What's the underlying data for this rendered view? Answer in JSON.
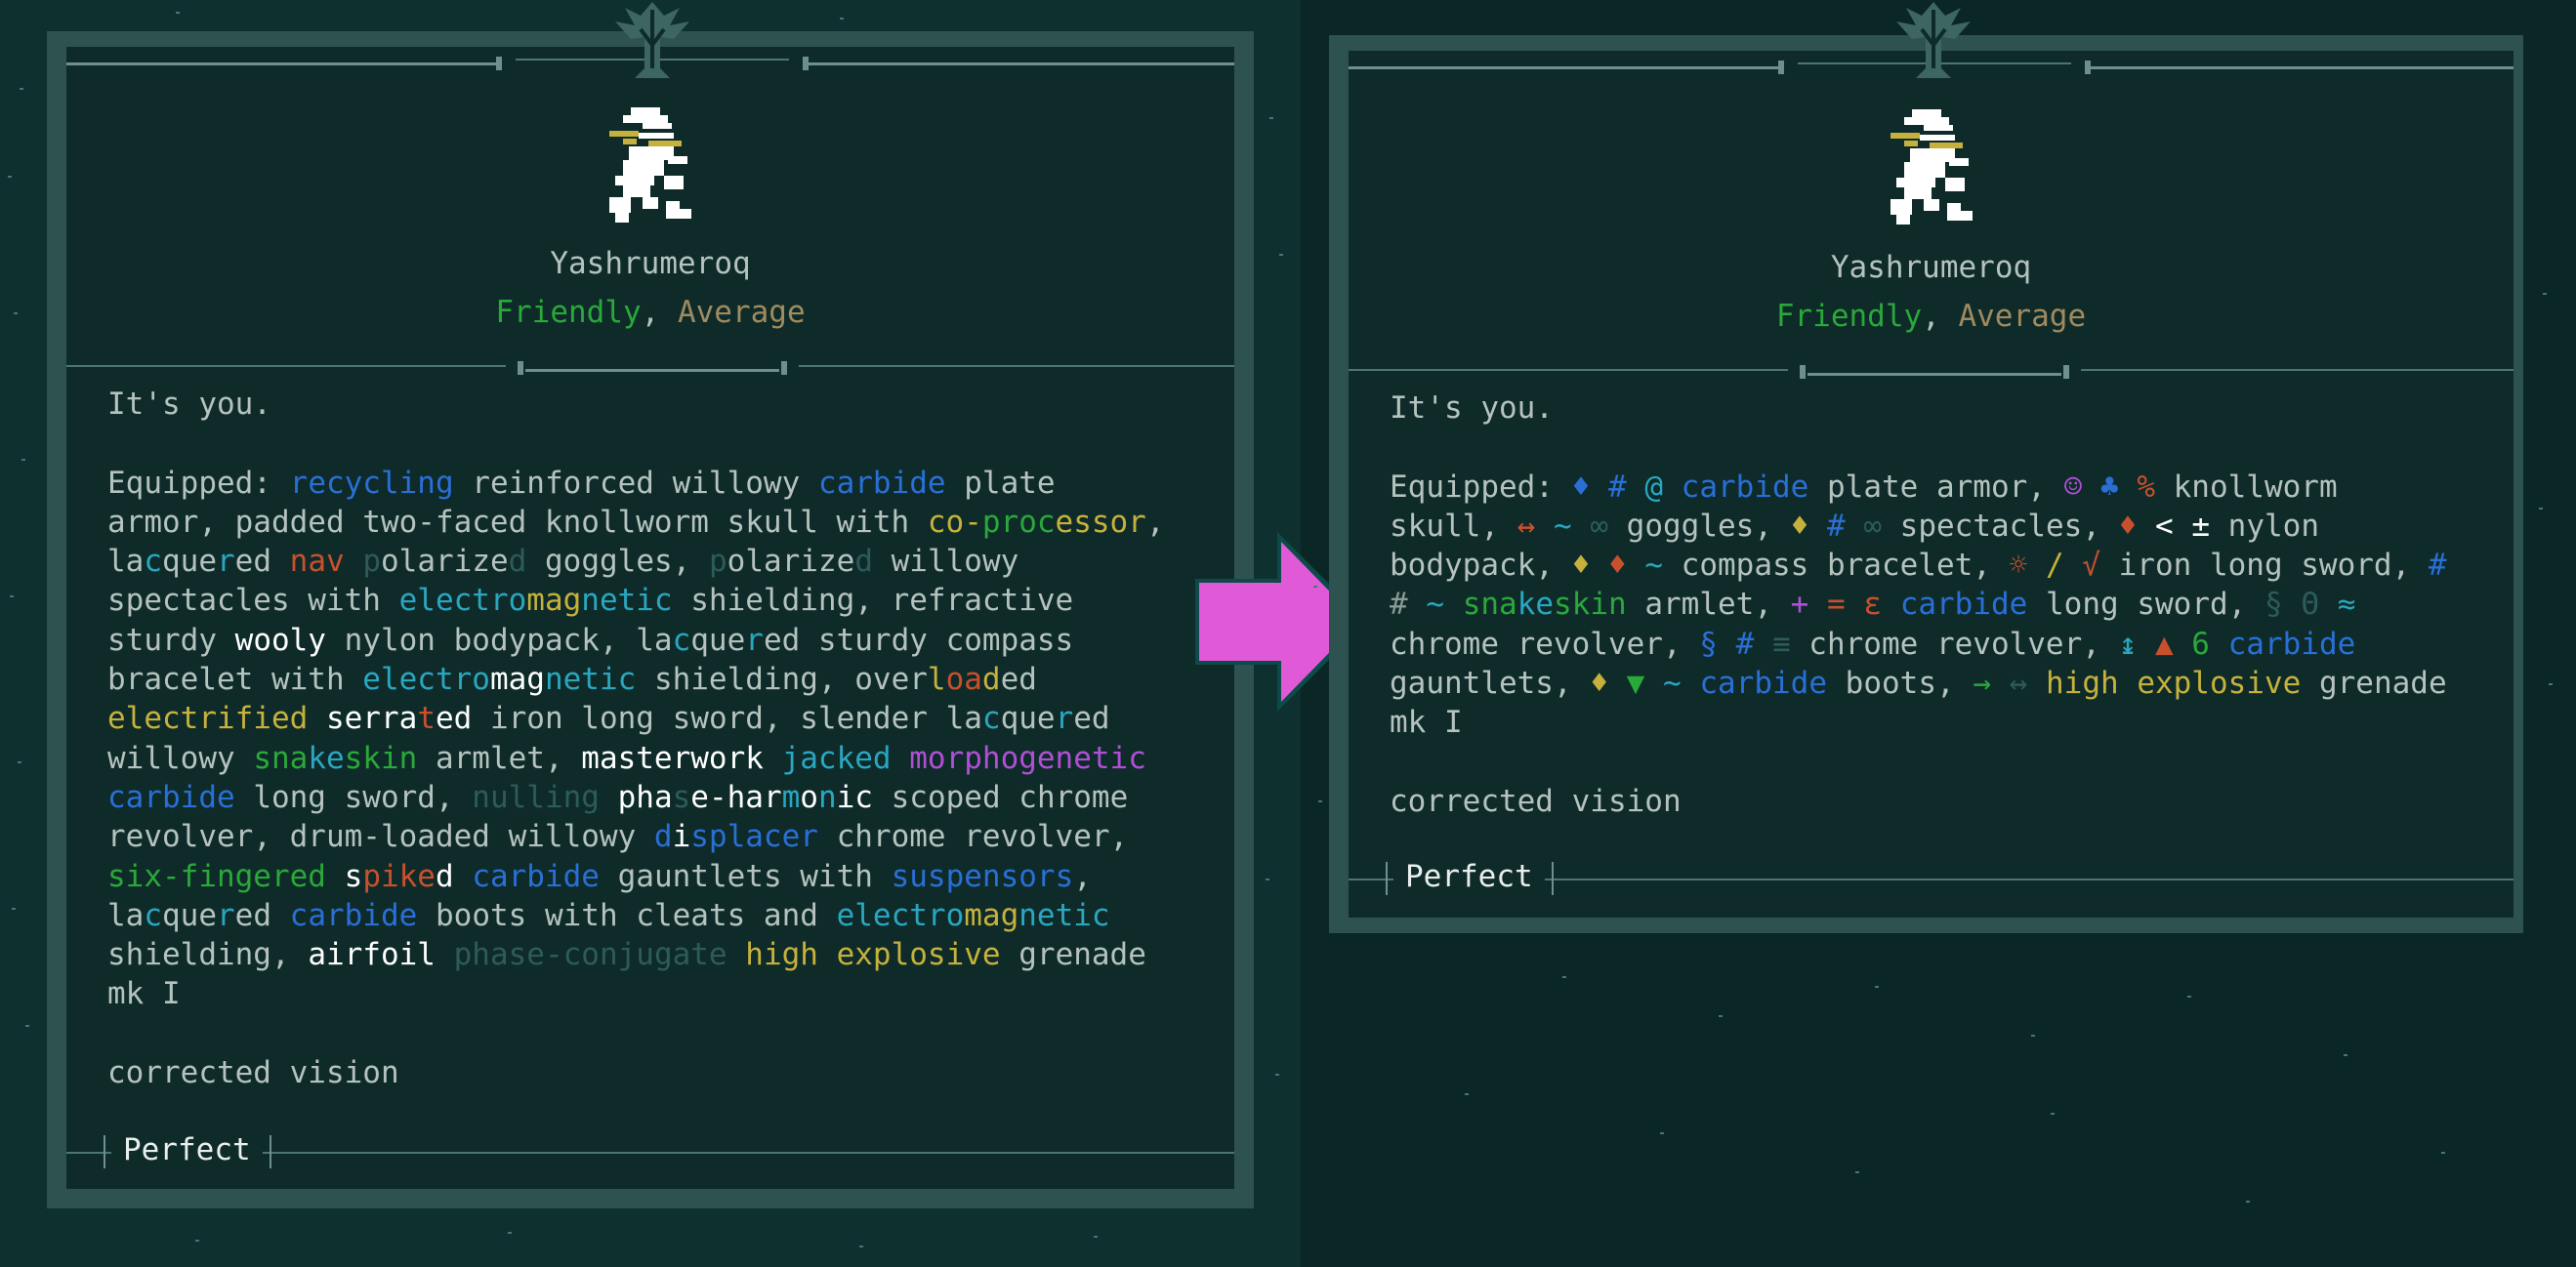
{
  "left_card": {
    "character_name": "Yashrumeroq",
    "attitude": {
      "relation": "Friendly",
      "separator": ", ",
      "rating": "Average"
    },
    "description": "It's you.",
    "equipped_label": "Equipped:",
    "mutation": "corrected vision",
    "health_status": "Perfect"
  },
  "right_card": {
    "character_name": "Yashrumeroq",
    "attitude": {
      "relation": "Friendly",
      "separator": ", ",
      "rating": "Average"
    },
    "description": "It's you.",
    "equipped_label": "Equipped:",
    "mutation": "corrected vision",
    "health_status": "Perfect"
  },
  "colors": {
    "friendly": "#2aa83a",
    "average": "#a08a5e",
    "arrow": "#e05ad8",
    "panel_bg": "#0e2b2a",
    "frame": "#2e5250"
  },
  "icons": [
    "portrait-sprite",
    "crest-ornament",
    "transition-arrow"
  ]
}
